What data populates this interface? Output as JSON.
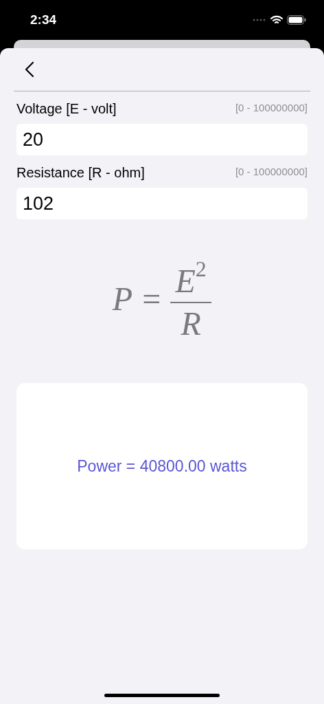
{
  "status_bar": {
    "time": "2:34"
  },
  "fields": [
    {
      "label": "Voltage [E - volt]",
      "range": "[0 - 100000000]",
      "value": "20"
    },
    {
      "label": "Resistance [R - ohm]",
      "range": "[0 - 100000000]",
      "value": "102"
    }
  ],
  "formula": {
    "lhs": "P",
    "operator": "=",
    "numerator": "E",
    "exponent": "2",
    "denominator": "R"
  },
  "result": "Power = 40800.00 watts"
}
